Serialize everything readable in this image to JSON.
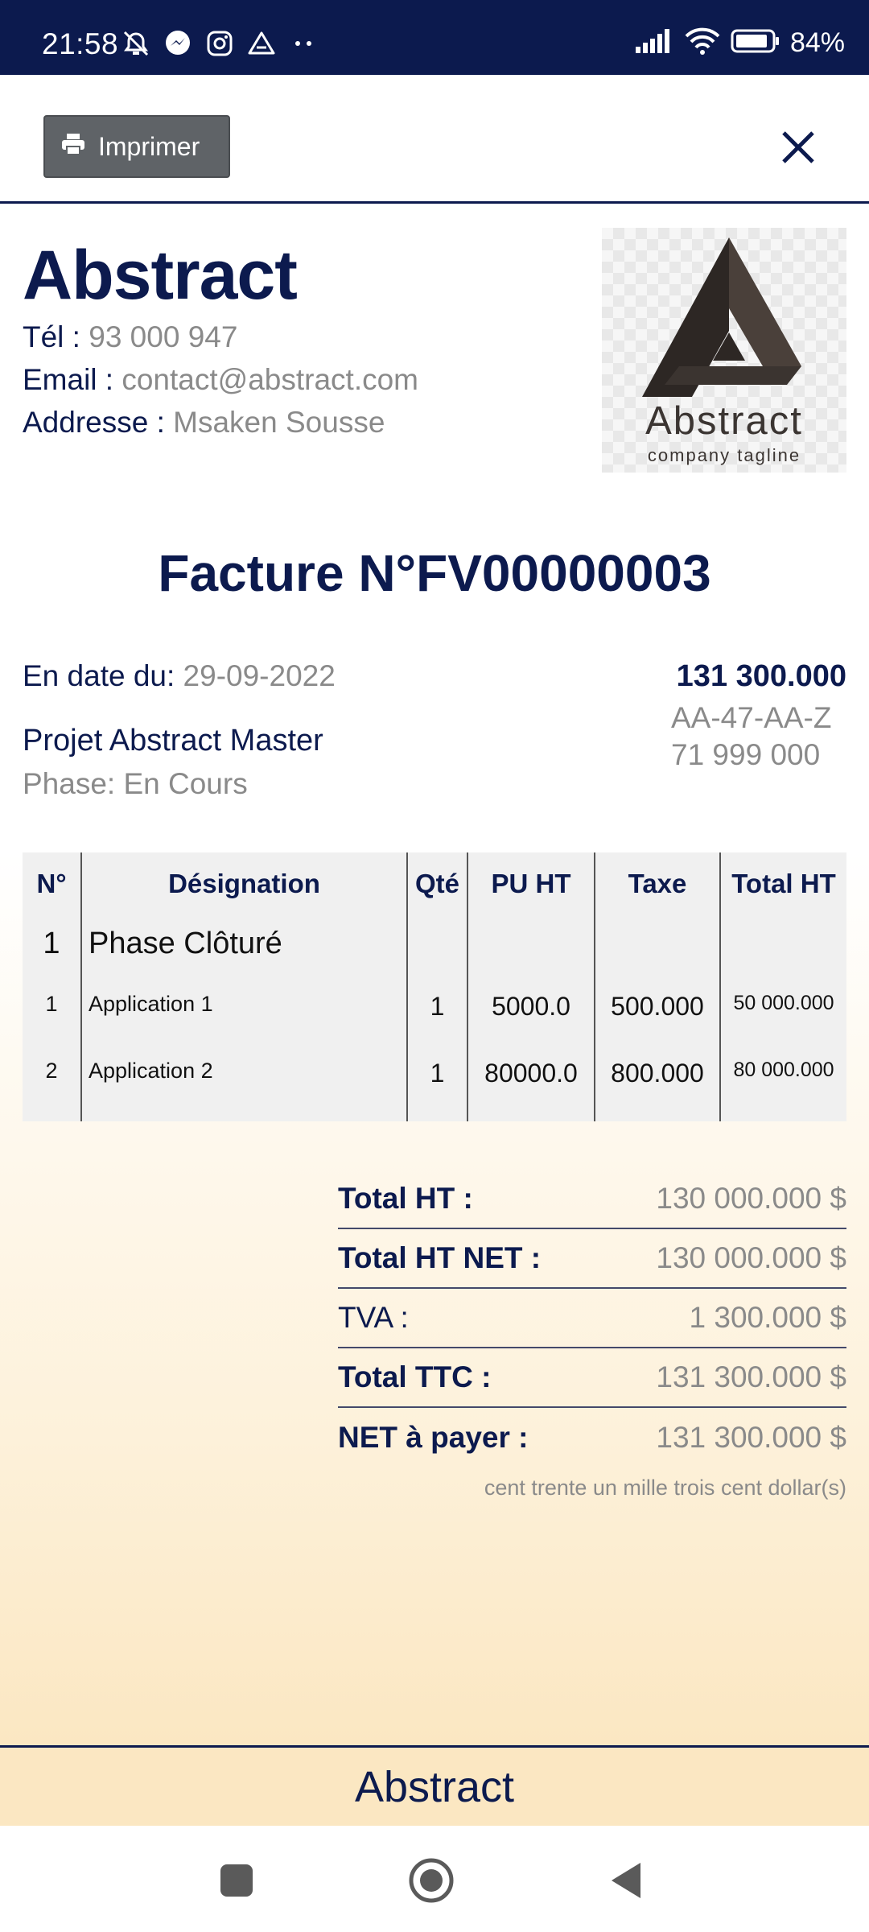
{
  "status_bar": {
    "time": "21:58",
    "battery": "84%",
    "left_icons": [
      "alarm-off-icon",
      "messenger-icon",
      "instagram-icon",
      "drive-icon",
      "more-dots-icon"
    ],
    "right_icons": [
      "signal-icon",
      "wifi-icon",
      "battery-icon"
    ]
  },
  "toolbar": {
    "print_label": "Imprimer",
    "print_icon": "printer-icon",
    "close_icon": "close-icon"
  },
  "company": {
    "name": "Abstract",
    "tel_label": "Tél :",
    "tel": "93 000 947",
    "email_label": "Email :",
    "email": "contact@abstract.com",
    "address_label": "Addresse :",
    "address": "Msaken Sousse",
    "logo_word": "Abstract",
    "logo_tagline": "company tagline"
  },
  "invoice": {
    "title": "Facture N°FV00000003",
    "date_label": "En date du:",
    "date": "29-09-2022",
    "project": "Projet Abstract Master",
    "phase": "Phase: En Cours",
    "client_total": "131 300.000",
    "client_ref": "AA-47-AA-Z",
    "client_phone": "71 999 000"
  },
  "table": {
    "headers": [
      "N°",
      "Désignation",
      "Qté",
      "PU HT",
      "Taxe",
      "Total HT"
    ],
    "group": {
      "no": "1",
      "label": "Phase Clôturé"
    },
    "rows": [
      {
        "no": "1",
        "designation": "Application 1",
        "qty": "1",
        "pu": "5000.0",
        "tax": "500.000",
        "total": "50 000.000"
      },
      {
        "no": "2",
        "designation": "Application 2",
        "qty": "1",
        "pu": "80000.0",
        "tax": "800.000",
        "total": "80 000.000"
      }
    ]
  },
  "totals": [
    {
      "label": "Total HT :",
      "value": "130 000.000 $"
    },
    {
      "label": "Total HT NET :",
      "value": "130 000.000 $"
    },
    {
      "label": "TVA :",
      "value": "1 300.000 $"
    },
    {
      "label": "Total TTC :",
      "value": "131 300.000 $"
    },
    {
      "label": "NET à payer :",
      "value": "131 300.000 $"
    }
  ],
  "amount_in_words": "cent trente un mille trois cent dollar(s)",
  "footer": {
    "text": "Abstract"
  },
  "nav": [
    "recents-button",
    "home-button",
    "back-button"
  ],
  "colors": {
    "navy": "#0c1a4e",
    "gray_text": "#8a8a8a",
    "button_gray": "#5f6367",
    "footer_bg": "#fbe7c2"
  }
}
